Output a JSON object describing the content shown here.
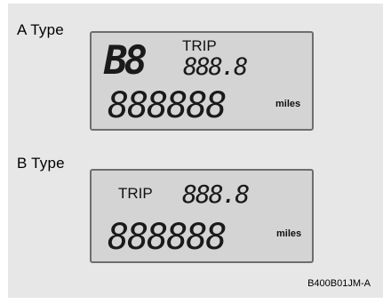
{
  "figure": {
    "code": "B400B01JM-A"
  },
  "type_a": {
    "label": "A Type",
    "gear_digits": "B8",
    "trip_label": "TRIP",
    "trip_digits": "888.8",
    "odo_digits": "888888",
    "unit": "miles"
  },
  "type_b": {
    "label": "B Type",
    "trip_label": "TRIP",
    "trip_digits": "888.8",
    "odo_digits": "888888",
    "unit": "miles"
  },
  "colors": {
    "panel_bg": "#e7e7e7",
    "lcd_bg": "#d4d4d4",
    "lcd_border": "#6e6e6e",
    "segment": "#1a1a1a"
  }
}
